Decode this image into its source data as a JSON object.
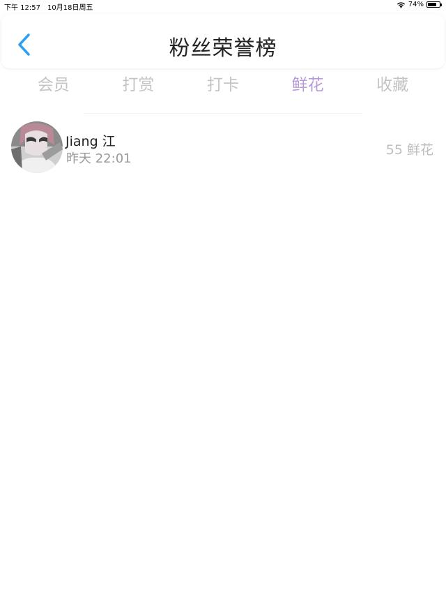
{
  "status_bar": {
    "time": "下午 12:57",
    "date": "10月18日周五",
    "battery_percent": "74%",
    "battery_level": 0.74
  },
  "header": {
    "title": "粉丝荣誉榜",
    "back_icon": "chevron-left-icon",
    "accent_color": "#2c9ff0"
  },
  "tabs": [
    {
      "label": "会员",
      "active": false
    },
    {
      "label": "打赏",
      "active": false
    },
    {
      "label": "打卡",
      "active": false
    },
    {
      "label": "鲜花",
      "active": true
    },
    {
      "label": "收藏",
      "active": false
    }
  ],
  "colors": {
    "tab_active": "#b79ad9",
    "tab_inactive": "#c4c4c4"
  },
  "list": [
    {
      "name": "Jiang 江",
      "time": "昨天 22:01",
      "amount": "55 鲜花"
    }
  ]
}
